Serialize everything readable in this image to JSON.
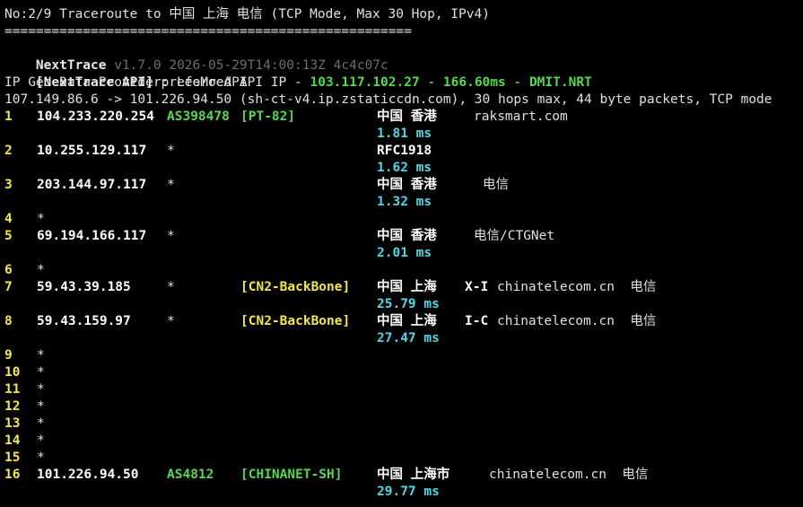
{
  "header": {
    "title_line": "No:2/9 Traceroute to 中国 上海 电信 (TCP Mode, Max 30 Hop, IPv4)",
    "separator": "====================================================",
    "app_name": "NextTrace",
    "version_info": " v1.7.0 2026-05-29T14:00:13Z 4c4c07c",
    "api_label": "[NextTrace API]",
    "api_text": " preferred API IP - ",
    "api_ip": "103.117.102.27",
    "api_dash1": " - ",
    "api_latency": "166.60ms",
    "api_dash2": " - ",
    "api_node": "DMIT.NRT",
    "geo_provider": "IP Geo Data Provider: LeoMoeAPI",
    "route_summary": "107.149.86.6 -> 101.226.94.50 (sh-ct-v4.ip.zstaticcdn.com), 30 hops max, 44 byte packets, TCP mode"
  },
  "hops": [
    {
      "num": "1",
      "ip": "104.233.220.254",
      "asn": "AS398478",
      "tag": "[PT-82]",
      "tag_color": "green",
      "geo": "中国 香港",
      "extra": "raksmart.com",
      "rtt": "1.81 ms"
    },
    {
      "num": "2",
      "ip": "10.255.129.117",
      "asn": "*",
      "tag": "",
      "tag_color": "",
      "geo": "RFC1918",
      "extra": "",
      "rtt": "1.62 ms"
    },
    {
      "num": "3",
      "ip": "203.144.97.117",
      "asn": "*",
      "tag": "",
      "tag_color": "",
      "geo": "中国 香港",
      "extra": "电信",
      "rtt": "1.32 ms"
    },
    {
      "num": "4",
      "ip": "*",
      "asn": "",
      "tag": "",
      "tag_color": "",
      "geo": "",
      "extra": "",
      "rtt": ""
    },
    {
      "num": "5",
      "ip": "69.194.166.117",
      "asn": "*",
      "tag": "",
      "tag_color": "",
      "geo": "中国 香港",
      "extra": "电信/CTGNet",
      "rtt": "2.01 ms"
    },
    {
      "num": "6",
      "ip": "*",
      "asn": "",
      "tag": "",
      "tag_color": "",
      "geo": "",
      "extra": "",
      "rtt": ""
    },
    {
      "num": "7",
      "ip": "59.43.39.185",
      "asn": "*",
      "tag": "[CN2-BackBone]",
      "tag_color": "yellow",
      "geo": "中国 上海",
      "geo_code": "X-I",
      "extra": "chinatelecom.cn  电信",
      "rtt": "25.79 ms"
    },
    {
      "num": "8",
      "ip": "59.43.159.97",
      "asn": "*",
      "tag": "[CN2-BackBone]",
      "tag_color": "yellow",
      "geo": "中国 上海",
      "geo_code": "I-C",
      "extra": "chinatelecom.cn  电信",
      "rtt": "27.47 ms"
    },
    {
      "num": "9",
      "ip": "*",
      "asn": "",
      "tag": "",
      "tag_color": "",
      "geo": "",
      "extra": "",
      "rtt": ""
    },
    {
      "num": "10",
      "ip": "*",
      "asn": "",
      "tag": "",
      "tag_color": "",
      "geo": "",
      "extra": "",
      "rtt": ""
    },
    {
      "num": "11",
      "ip": "*",
      "asn": "",
      "tag": "",
      "tag_color": "",
      "geo": "",
      "extra": "",
      "rtt": ""
    },
    {
      "num": "12",
      "ip": "*",
      "asn": "",
      "tag": "",
      "tag_color": "",
      "geo": "",
      "extra": "",
      "rtt": ""
    },
    {
      "num": "13",
      "ip": "*",
      "asn": "",
      "tag": "",
      "tag_color": "",
      "geo": "",
      "extra": "",
      "rtt": ""
    },
    {
      "num": "14",
      "ip": "*",
      "asn": "",
      "tag": "",
      "tag_color": "",
      "geo": "",
      "extra": "",
      "rtt": ""
    },
    {
      "num": "15",
      "ip": "*",
      "asn": "",
      "tag": "",
      "tag_color": "",
      "geo": "",
      "extra": "",
      "rtt": ""
    },
    {
      "num": "16",
      "ip": "101.226.94.50",
      "asn": "AS4812",
      "tag": "[CHINANET-SH]",
      "tag_color": "green",
      "geo": "中国 上海市",
      "extra": "chinatelecom.cn  电信",
      "rtt": "29.77 ms"
    }
  ],
  "colors": {
    "background": "#000000",
    "text": "#d7d7d7",
    "green": "#56d94f",
    "yellow": "#f3e94a",
    "cyan": "#53d6e6",
    "grey": "#6e6e6e"
  }
}
